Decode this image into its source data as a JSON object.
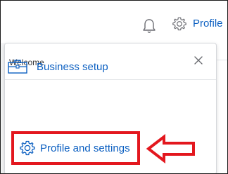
{
  "header": {
    "notifications_icon": "bell-icon",
    "settings_icon": "gear-icon",
    "profile_label": "Profile"
  },
  "menu": {
    "welcome_label": "Welcome",
    "close_icon": "close-icon",
    "items": [
      {
        "label": "Business setup",
        "icon": "briefcase-icon"
      },
      {
        "label": "Profile and settings",
        "icon": "gear-icon",
        "highlighted": true
      }
    ]
  },
  "annotation": {
    "highlight_color": "#e3171e",
    "pointer": "left-arrow"
  },
  "colors": {
    "link": "#0b5fc1",
    "text": "#393a3d",
    "highlight": "#e3171e"
  }
}
